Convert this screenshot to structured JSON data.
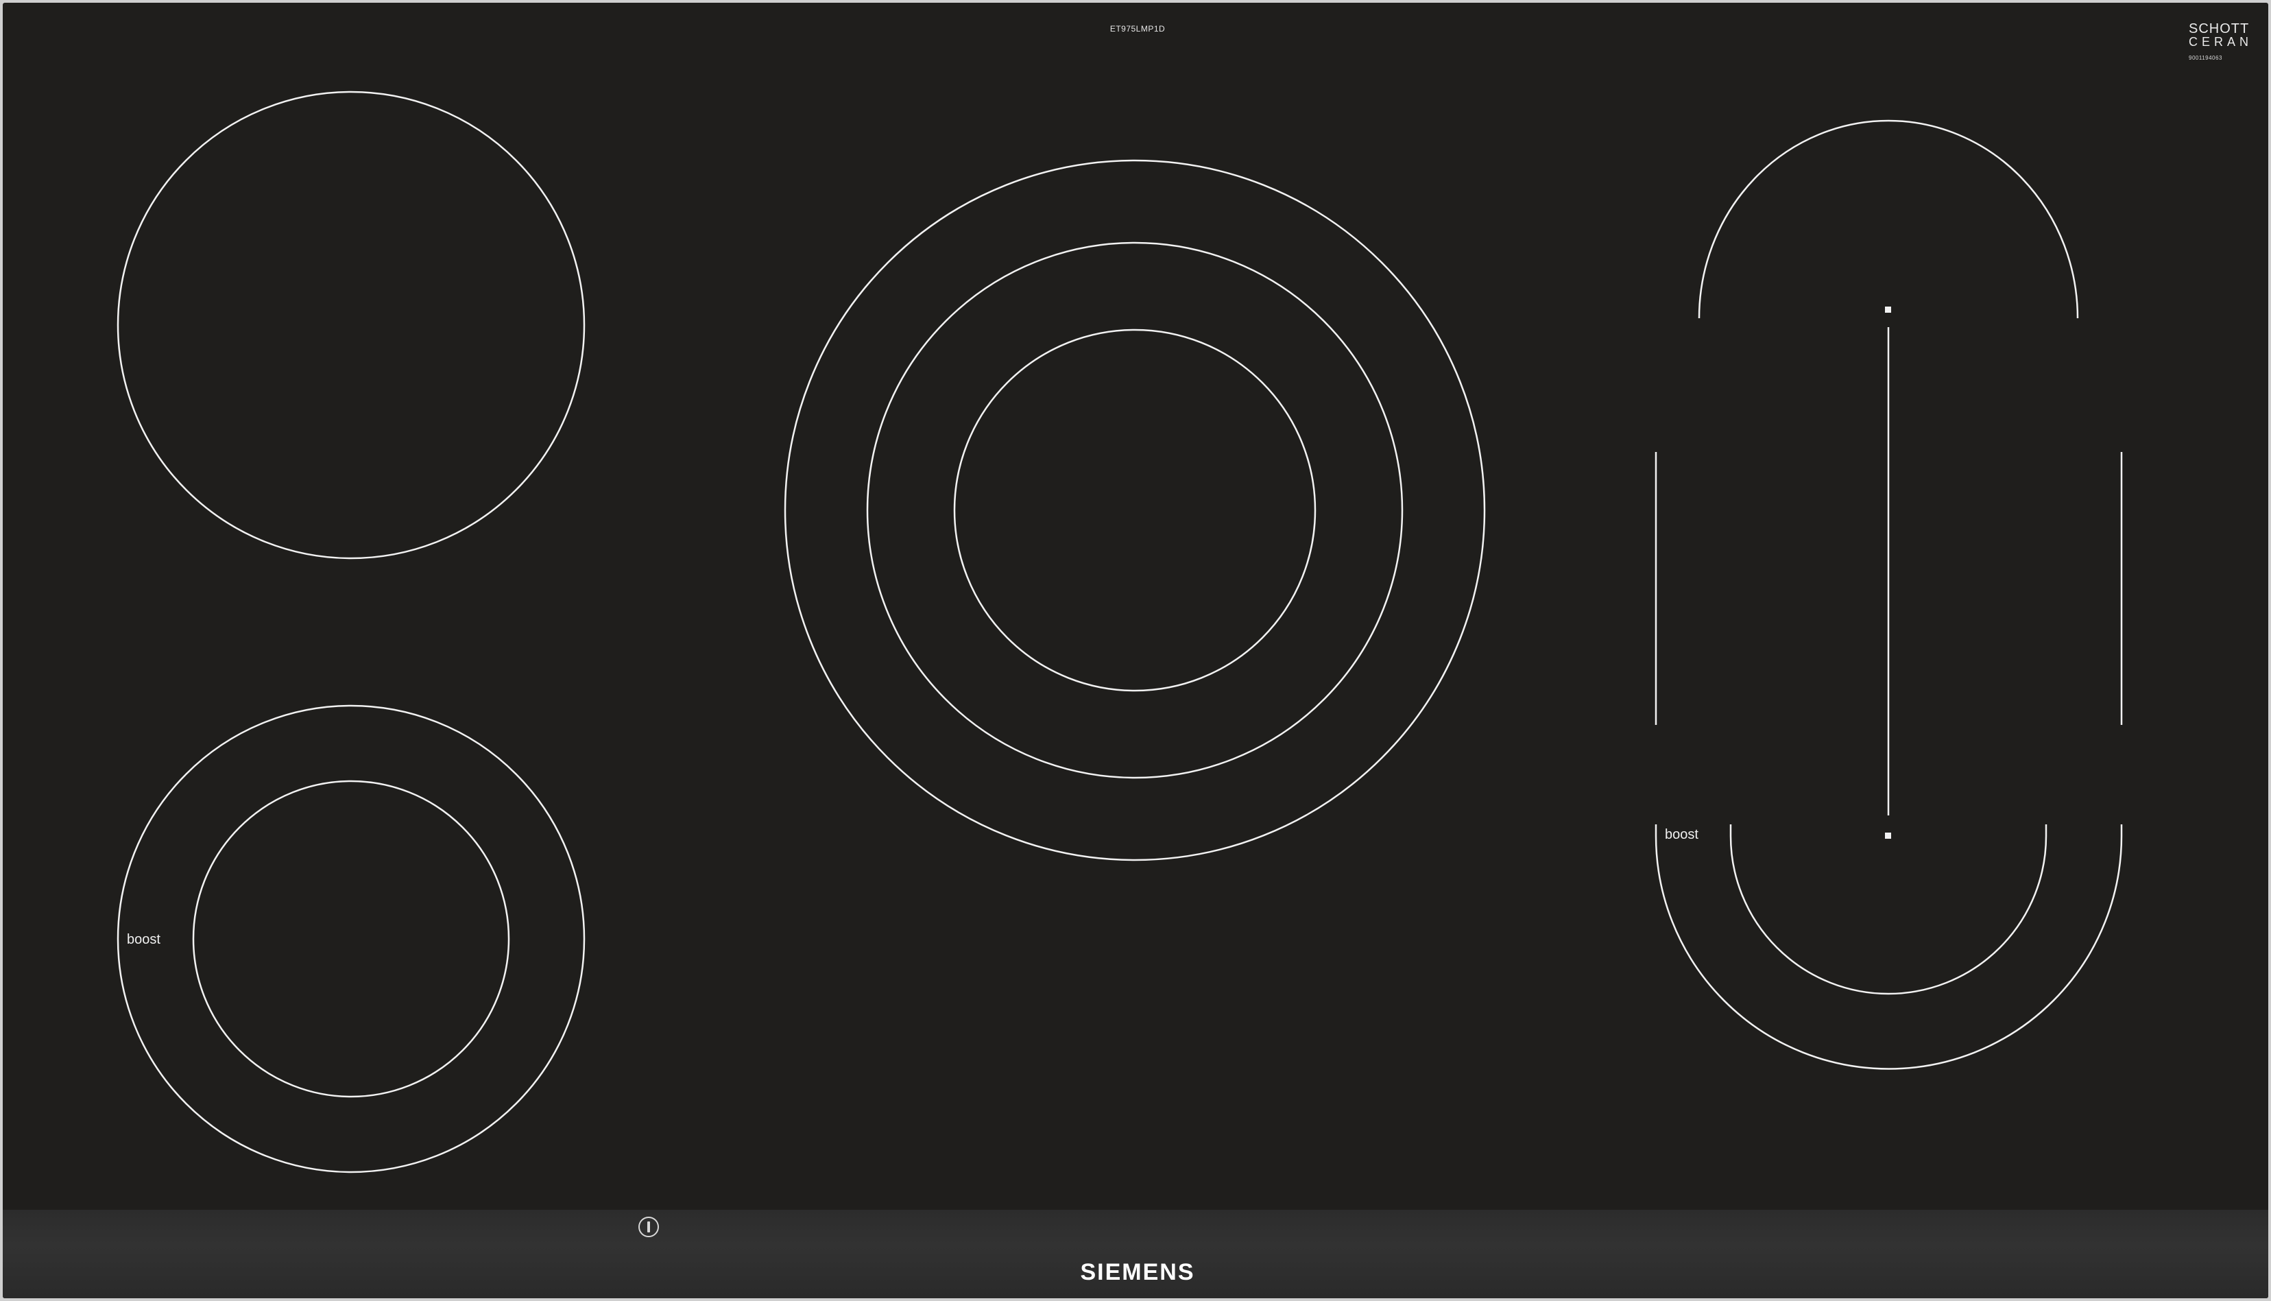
{
  "hob": {
    "model_code": "ET975LMP1D",
    "glass_brand": {
      "line1": "SCHOTT",
      "line2": "CERAN",
      "serial": "9001194063"
    },
    "boost_label_left": "boost",
    "boost_label_right": "boost",
    "brand": "SIEMENS",
    "icons": [
      "power-icon"
    ],
    "colors": {
      "glass": "#1f1e1c",
      "markings": "#f2f2f2",
      "control_strip": "#2e2e2e",
      "frame": "#cfcfcf"
    }
  }
}
